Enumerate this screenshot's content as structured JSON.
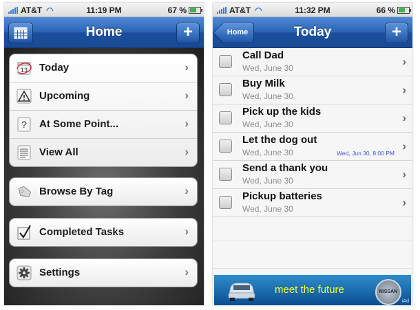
{
  "left_screen": {
    "status_bar": {
      "carrier": "AT&T",
      "time": "11:19 PM",
      "battery": "67 %",
      "battery_level": 0.67
    },
    "nav": {
      "title": "Home",
      "add_label": "+"
    },
    "calendar_icon_day": "13",
    "menu": {
      "today": "Today",
      "upcoming": "Upcoming",
      "at_some_point": "At Some Point...",
      "view_all": "View All",
      "browse_by_tag": "Browse By Tag",
      "completed_tasks": "Completed Tasks",
      "settings": "Settings"
    },
    "chevron": "›"
  },
  "right_screen": {
    "status_bar": {
      "carrier": "AT&T",
      "time": "11:32 PM",
      "battery": "66 %",
      "battery_level": 0.66
    },
    "nav": {
      "title": "Today",
      "back_label": "Home",
      "add_label": "+"
    },
    "tasks": [
      {
        "title": "Call Dad",
        "date": "Wed, June 30"
      },
      {
        "title": "Buy Milk",
        "date": "Wed, June 30"
      },
      {
        "title": "Pick up the kids",
        "date": "Wed, June 30"
      },
      {
        "title": "Let the dog out",
        "date": "Wed, June 30",
        "reminder": "Wed, Jun 30, 8:00 PM"
      },
      {
        "title": "Send a thank you",
        "date": "Wed, June 30"
      },
      {
        "title": "Pickup batteries",
        "date": "Wed, June 30"
      }
    ],
    "ad": {
      "text": "meet the future",
      "brand": "NISSAN",
      "badge": "iAd"
    },
    "chevron": "›"
  }
}
